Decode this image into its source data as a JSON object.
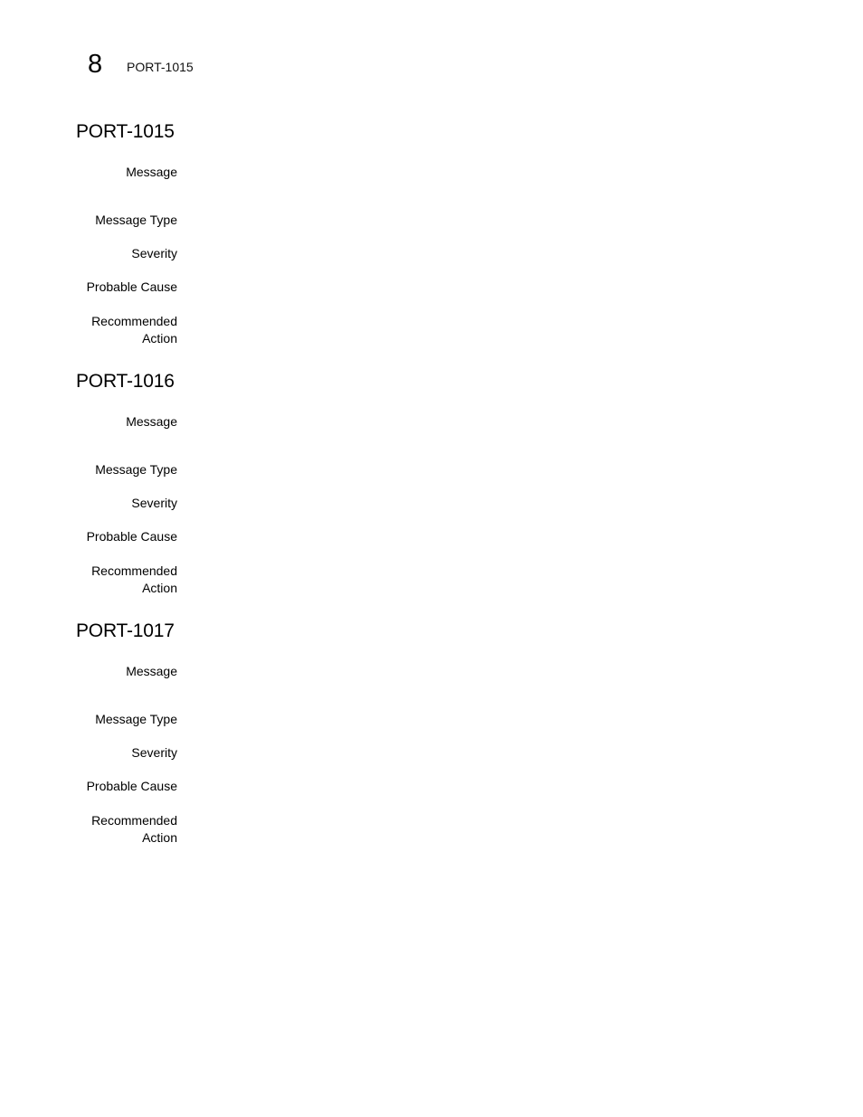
{
  "header": {
    "chapter_number": "8",
    "running_title": "PORT-1015"
  },
  "sections": [
    {
      "title": "PORT-1015",
      "fields": [
        {
          "label": "Message",
          "value": ""
        },
        {
          "label": "Message Type",
          "value": ""
        },
        {
          "label": "Severity",
          "value": ""
        },
        {
          "label": "Probable Cause",
          "value": ""
        },
        {
          "label": "Recommended Action",
          "value": ""
        }
      ]
    },
    {
      "title": "PORT-1016",
      "fields": [
        {
          "label": "Message",
          "value": ""
        },
        {
          "label": "Message Type",
          "value": ""
        },
        {
          "label": "Severity",
          "value": ""
        },
        {
          "label": "Probable Cause",
          "value": ""
        },
        {
          "label": "Recommended Action",
          "value": ""
        }
      ]
    },
    {
      "title": "PORT-1017",
      "fields": [
        {
          "label": "Message",
          "value": ""
        },
        {
          "label": "Message Type",
          "value": ""
        },
        {
          "label": "Severity",
          "value": ""
        },
        {
          "label": "Probable Cause",
          "value": ""
        },
        {
          "label": "Recommended Action",
          "value": ""
        }
      ]
    }
  ]
}
